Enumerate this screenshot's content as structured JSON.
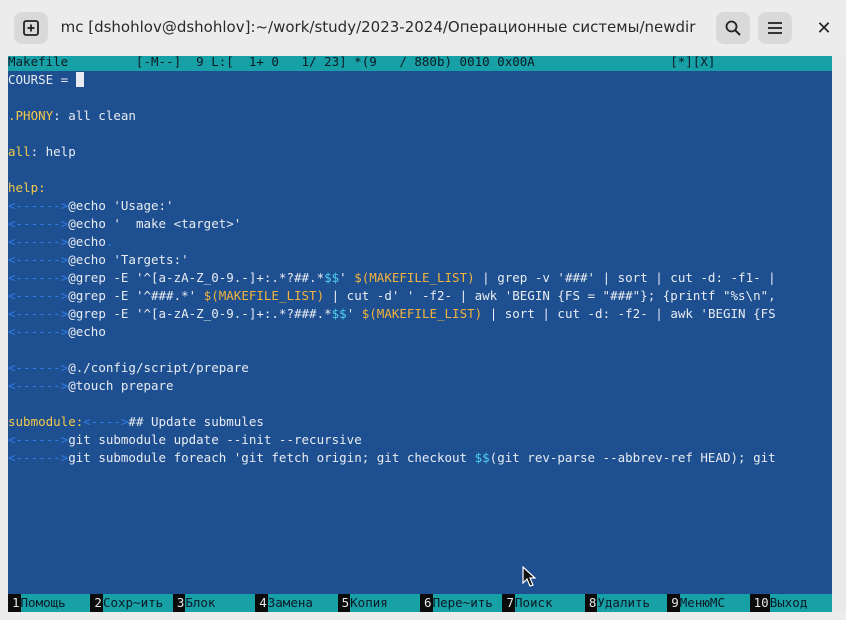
{
  "titlebar": {
    "title": "mc [dshohlov@dshohlov]:~/work/study/2023-2024/Операционные системы/newdir",
    "new_tab_icon": "new-tab-icon",
    "search_icon": "search-icon",
    "menu_icon": "hamburger-menu-icon",
    "close_label": "✕"
  },
  "editor": {
    "status_line": "Makefile         [-M--]  9 L:[  1+ 0   1/ 23] *(9   / 880b) 0010 0x00A                  [*][X]",
    "tab_marker": "<------>",
    "tab_marker_short": "<---->",
    "lines": {
      "l1": "COURSE = ",
      "l3a": ".PHONY",
      "l3b": ": all clean",
      "l5a": "all",
      "l5b": ": help",
      "l7a": "help",
      "l7b": ":",
      "l8": "@echo 'Usage:'",
      "l9": "@echo '  make <target>'",
      "l10a": "@echo",
      "l10b": ".",
      "l11": "@echo 'Targets:'",
      "l12a": "@grep -E '^[a-zA-Z_0-9.-]+:.*?##.*",
      "l12b": "$$",
      "l12c": "' ",
      "l12d": "$(MAKEFILE_LIST)",
      "l12e": " | grep -v '###' | sort | cut -d: -f1- |",
      "l13a": "@grep -E '^###.*' ",
      "l13b": "$(MAKEFILE_LIST)",
      "l13c": " | cut -d' ' -f2- | awk 'BEGIN {FS = \"###\"}; {printf \"%s\\n\",",
      "l14a": "@grep -E '^[a-zA-Z_0-9.-]+:.*?###.*",
      "l14b": "$$",
      "l14c": "' ",
      "l14d": "$(MAKEFILE_LIST)",
      "l14e": " | sort | cut -d: -f2- | awk 'BEGIN {FS",
      "l15": "@echo",
      "l17": "@./config/script/prepare",
      "l18": "@touch prepare",
      "l20a": "submodule",
      "l20b": ":",
      "l20c": "## Update submules",
      "l21": "git submodule update --init --recursive",
      "l22a": "git submodule foreach 'git fetch origin; git checkout ",
      "l22b": "$$",
      "l22c": "(git rev-parse --abbrev-ref HEAD); git"
    }
  },
  "fkeys": [
    {
      "num": "1",
      "label": "Помощь"
    },
    {
      "num": "2",
      "label": "Сохр~ить"
    },
    {
      "num": "3",
      "label": "Блок"
    },
    {
      "num": "4",
      "label": "Замена"
    },
    {
      "num": "5",
      "label": "Копия"
    },
    {
      "num": "6",
      "label": "Пере~ить"
    },
    {
      "num": "7",
      "label": "Поиск"
    },
    {
      "num": "8",
      "label": "Удалить"
    },
    {
      "num": "9",
      "label": "МенюMC"
    },
    {
      "num": "10",
      "label": "Выход"
    }
  ],
  "colors": {
    "terminal_bg": "#1e4f90",
    "status_bg": "#17a0a6",
    "tab_marker": "#2f7de6",
    "keyword": "#f3c94a",
    "dollar": "#4fd3f0"
  }
}
